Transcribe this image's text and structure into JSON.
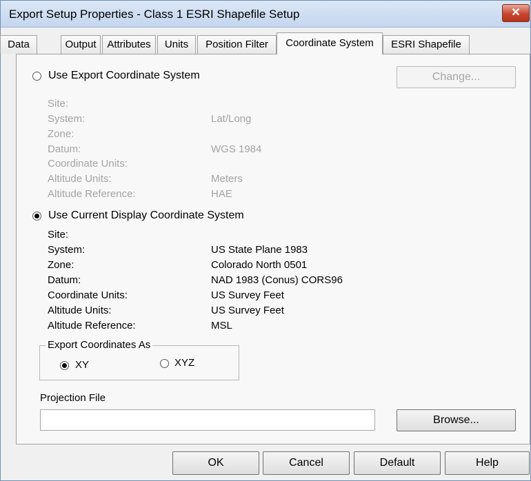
{
  "window": {
    "title": "Export Setup Properties - Class 1 ESRI Shapefile Setup",
    "close_glyph": "✕"
  },
  "tabs": [
    {
      "label": "Data"
    },
    {
      "label": "Output"
    },
    {
      "label": "Attributes"
    },
    {
      "label": "Units"
    },
    {
      "label": "Position Filter"
    },
    {
      "label": "Coordinate System",
      "active": true
    },
    {
      "label": "ESRI Shapefile"
    }
  ],
  "export_cs": {
    "option_label": "Use Export Coordinate System",
    "selected": false,
    "change_label": "Change...",
    "fields": [
      {
        "label": "Site:",
        "value": ""
      },
      {
        "label": "System:",
        "value": "Lat/Long"
      },
      {
        "label": "Zone:",
        "value": ""
      },
      {
        "label": "Datum:",
        "value": "WGS 1984"
      },
      {
        "label": "Coordinate Units:",
        "value": ""
      },
      {
        "label": "Altitude Units:",
        "value": "Meters"
      },
      {
        "label": "Altitude Reference:",
        "value": "HAE"
      }
    ]
  },
  "current_cs": {
    "option_label": "Use Current Display Coordinate System",
    "selected": true,
    "fields": [
      {
        "label": "Site:",
        "value": ""
      },
      {
        "label": "System:",
        "value": "US State Plane 1983"
      },
      {
        "label": "Zone:",
        "value": "Colorado North 0501"
      },
      {
        "label": "Datum:",
        "value": "NAD 1983 (Conus) CORS96"
      },
      {
        "label": "Coordinate Units:",
        "value": "US Survey Feet"
      },
      {
        "label": "Altitude Units:",
        "value": "US Survey Feet"
      },
      {
        "label": "Altitude Reference:",
        "value": "MSL"
      }
    ]
  },
  "export_coords": {
    "group_label": "Export Coordinates As",
    "xy_label": "XY",
    "xyz_label": "XYZ",
    "selected": "XY"
  },
  "projection": {
    "label": "Projection File",
    "value": "",
    "placeholder": "",
    "browse_label": "Browse..."
  },
  "footer": {
    "ok": "OK",
    "cancel": "Cancel",
    "default": "Default",
    "help": "Help"
  }
}
